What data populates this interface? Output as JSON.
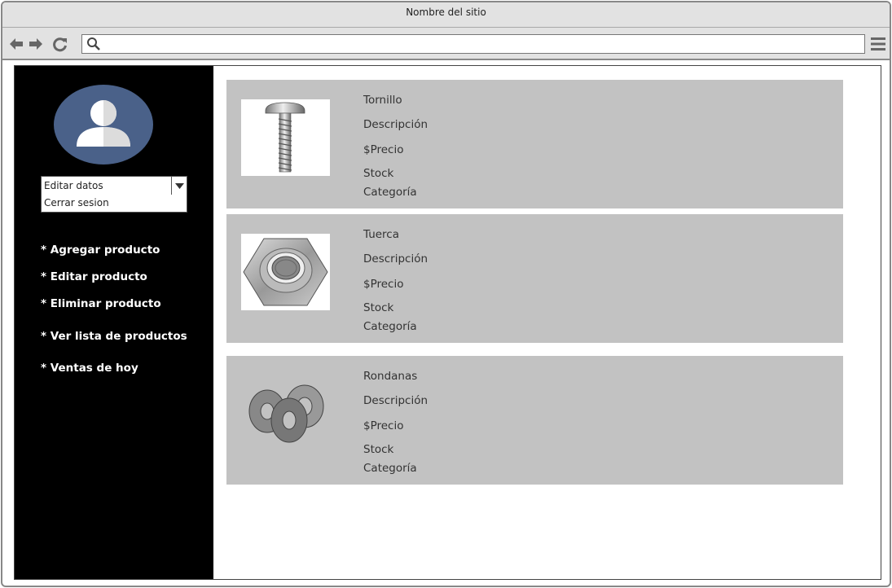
{
  "browser": {
    "title": "Nombre del sitio",
    "address_value": "",
    "icons": [
      "back-arrow-icon",
      "forward-arrow-icon",
      "reload-icon",
      "search-icon",
      "hamburger-menu-icon"
    ]
  },
  "sidebar": {
    "avatar_icon": "user-avatar-icon",
    "account_dropdown": {
      "selected": "Editar datos",
      "options": [
        "Cerrar sesion"
      ]
    },
    "menu": [
      "* Agregar producto",
      "* Editar producto",
      "* Eliminar producto",
      "* Ver lista de productos",
      "* Ventas de hoy"
    ]
  },
  "products": [
    {
      "name": "Tornillo",
      "description": "Descripción",
      "price": "$Precio",
      "stock": "Stock",
      "category": "Categoría",
      "image": "screw-image"
    },
    {
      "name": "Tuerca",
      "description": "Descripción",
      "price": "$Precio",
      "stock": "Stock",
      "category": "Categoría",
      "image": "hex-nut-image"
    },
    {
      "name": "Rondanas",
      "description": "Descripción",
      "price": "$Precio",
      "stock": "Stock",
      "category": "Categoría",
      "image": "washers-image"
    }
  ],
  "colors": {
    "sidebar_bg": "#000000",
    "card_bg": "#c2c2c2",
    "avatar_bg": "#4a6189",
    "chrome_bg": "#e2e2e2"
  }
}
